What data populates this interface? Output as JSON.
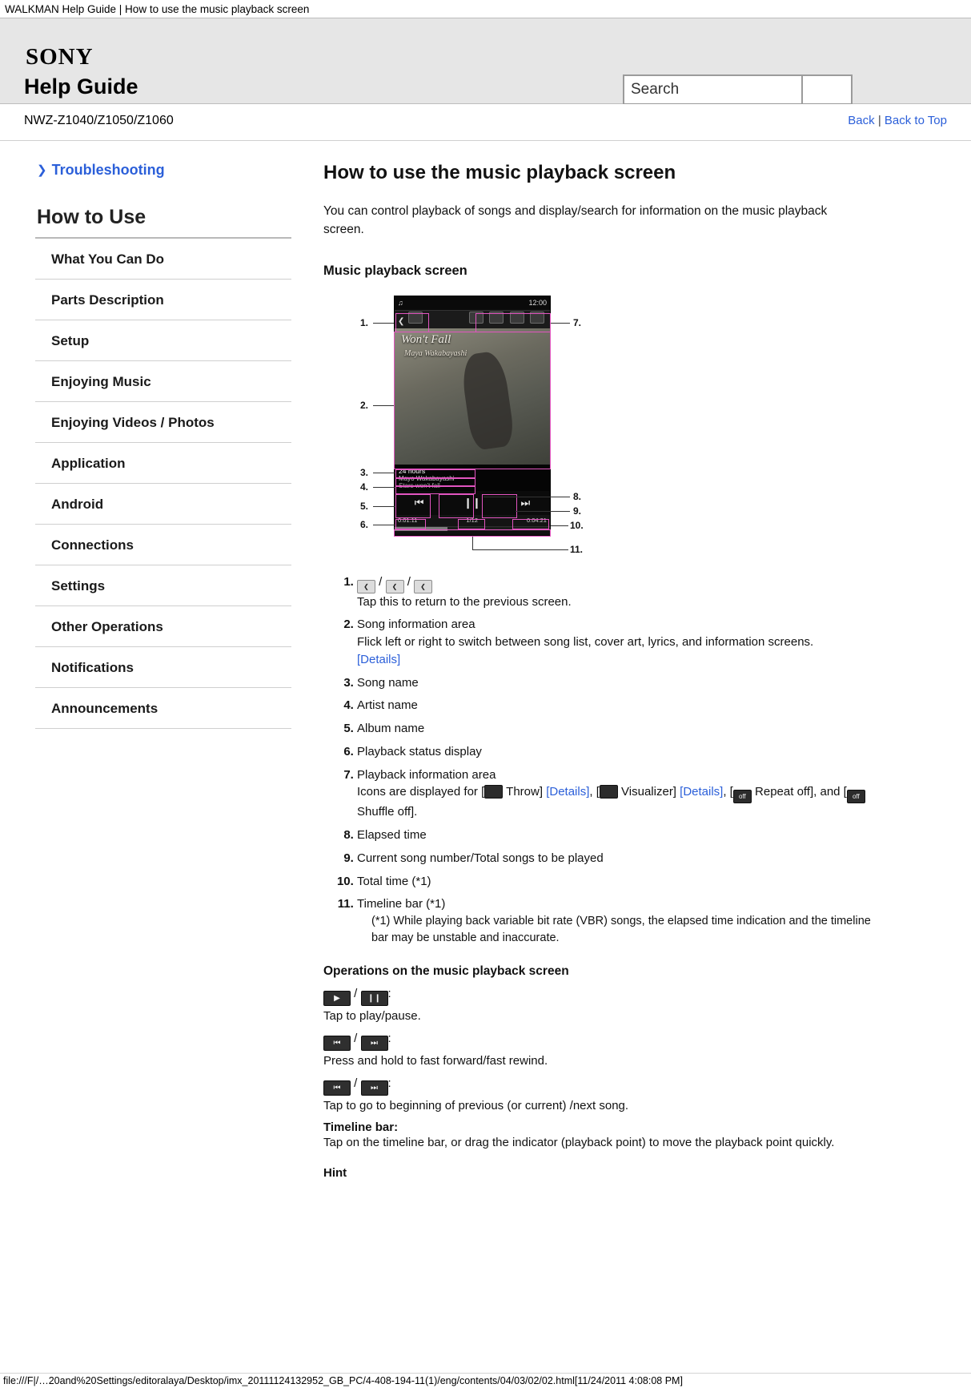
{
  "browser": {
    "title": "WALKMAN Help Guide | How to use the music playback screen",
    "status_url": "file:///F|/…20and%20Settings/editoralaya/Desktop/imx_20111124132952_GB_PC/4-408-194-11(1)/eng/contents/04/03/02/02.html[11/24/2011 4:08:08 PM]"
  },
  "header": {
    "logo": "SONY",
    "title": "Help Guide",
    "search_value": "Search",
    "search_placeholder": "Search",
    "search_button_label": ""
  },
  "modelbar": {
    "model": "NWZ-Z1040/Z1050/Z1060",
    "back": "Back",
    "separator": "|",
    "back_to_top": "Back to Top"
  },
  "sidebar": {
    "troubleshooting": "Troubleshooting",
    "heading": "How to Use",
    "items": [
      {
        "label": "What You Can Do"
      },
      {
        "label": "Parts Description"
      },
      {
        "label": "Setup"
      },
      {
        "label": "Enjoying Music"
      },
      {
        "label": "Enjoying Videos / Photos"
      },
      {
        "label": "Application"
      },
      {
        "label": "Android"
      },
      {
        "label": "Connections"
      },
      {
        "label": "Settings"
      },
      {
        "label": "Other Operations"
      },
      {
        "label": "Notifications"
      },
      {
        "label": "Announcements"
      }
    ]
  },
  "main": {
    "title": "How to use the music playback screen",
    "intro": "You can control playback of songs and display/search for information on the music playback screen.",
    "section_music_screen": "Music playback screen",
    "figure": {
      "callouts_left": [
        "1",
        "2",
        "3",
        "4",
        "5",
        "6"
      ],
      "callouts_right": [
        "7",
        "8",
        "9",
        "10",
        "11"
      ],
      "status_time": "12:00",
      "art_title": "Won't Fall",
      "art_sub": "Maya Wakabayashi",
      "song_line1": "24 hours",
      "song_line2": "Mayo Wakabayashi",
      "song_line3": "Stars won't fall",
      "elapsed": "0:01:11",
      "track_count": "1/12",
      "total_time": "0:04:21"
    },
    "steps": [
      {
        "num": "1.",
        "text": "Tap this to return to the previous screen.",
        "icons": [
          "back-library-icon",
          "back-lyrics-icon",
          "back-info-icon"
        ]
      },
      {
        "num": "2.",
        "title": "Song information area",
        "text": "Flick left or right to switch between song list, cover art, lyrics, and information screens.",
        "link": "[Details]"
      },
      {
        "num": "3.",
        "title": "Song name"
      },
      {
        "num": "4.",
        "title": "Artist name"
      },
      {
        "num": "5.",
        "title": "Album name"
      },
      {
        "num": "6.",
        "title": "Playback status display"
      },
      {
        "num": "7.",
        "title": "Playback information area",
        "text_parts": {
          "p1": "Icons are displayed for [",
          "throw": " Throw]",
          "details1": "[Details]",
          "p2": ", [",
          "visualizer": " Visualizer]",
          "details2": "[Details]",
          "p3": ", [",
          "repeat": " Repeat off], and [",
          "shuffle": " Shuffle off]."
        }
      },
      {
        "num": "8.",
        "title": "Elapsed time"
      },
      {
        "num": "9.",
        "title": "Current song number/Total songs to be played"
      },
      {
        "num": "10.",
        "title": "Total time (*1)"
      },
      {
        "num": "11.",
        "title": "Timeline bar (*1)",
        "footnote": "(*1) While playing back variable bit rate (VBR) songs, the elapsed time indication and the timeline bar may be unstable and inaccurate."
      }
    ],
    "operations": {
      "heading": "Operations on the music playback screen",
      "rows": [
        {
          "icon_a": "play-icon",
          "icon_b": "pause-icon",
          "sep": "/",
          "colon": ":",
          "desc": "Tap to play/pause."
        },
        {
          "icon_a": "prev-icon",
          "icon_b": "next-icon",
          "sep": "/",
          "colon": ":",
          "desc": "Press and hold to fast forward/fast rewind."
        },
        {
          "icon_a": "prev-icon",
          "icon_b": "next-icon",
          "sep": "/",
          "colon": ":",
          "desc": "Tap to go to beginning of previous (or current) /next song."
        }
      ],
      "timeline_label": "Timeline bar:",
      "timeline_desc": "Tap on the timeline bar, or drag the indicator (playback point) to move the playback point quickly."
    },
    "hint": "Hint"
  }
}
